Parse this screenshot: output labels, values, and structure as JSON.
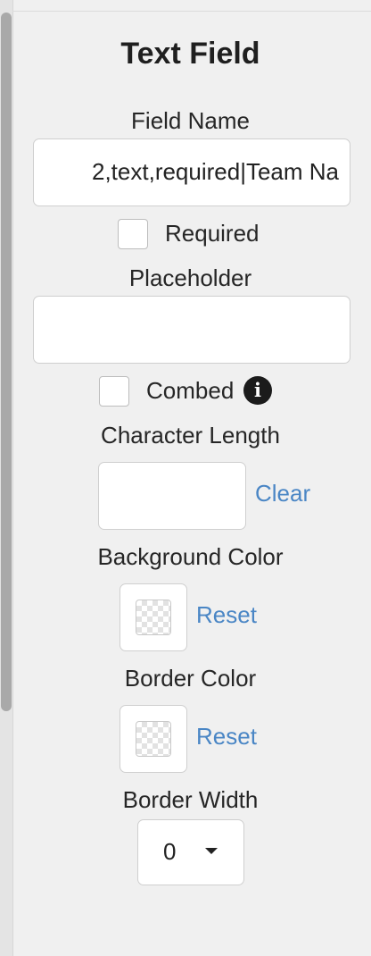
{
  "panel": {
    "title": "Text Field",
    "field_name": {
      "label": "Field Name",
      "value": "2,text,required|Team Na"
    },
    "required": {
      "label": "Required",
      "checked": false
    },
    "placeholder": {
      "label": "Placeholder",
      "value": ""
    },
    "combed": {
      "label": "Combed",
      "checked": false,
      "info_icon": "info-circle-icon",
      "info_glyph": "i"
    },
    "character_length": {
      "label": "Character Length",
      "value": "",
      "clear_label": "Clear"
    },
    "background_color": {
      "label": "Background Color",
      "value": "transparent",
      "reset_label": "Reset"
    },
    "border_color": {
      "label": "Border Color",
      "value": "transparent",
      "reset_label": "Reset"
    },
    "border_width": {
      "label": "Border Width",
      "value": "0"
    }
  },
  "colors": {
    "link": "#4a86c5",
    "panel_bg": "#f0f0f0"
  }
}
